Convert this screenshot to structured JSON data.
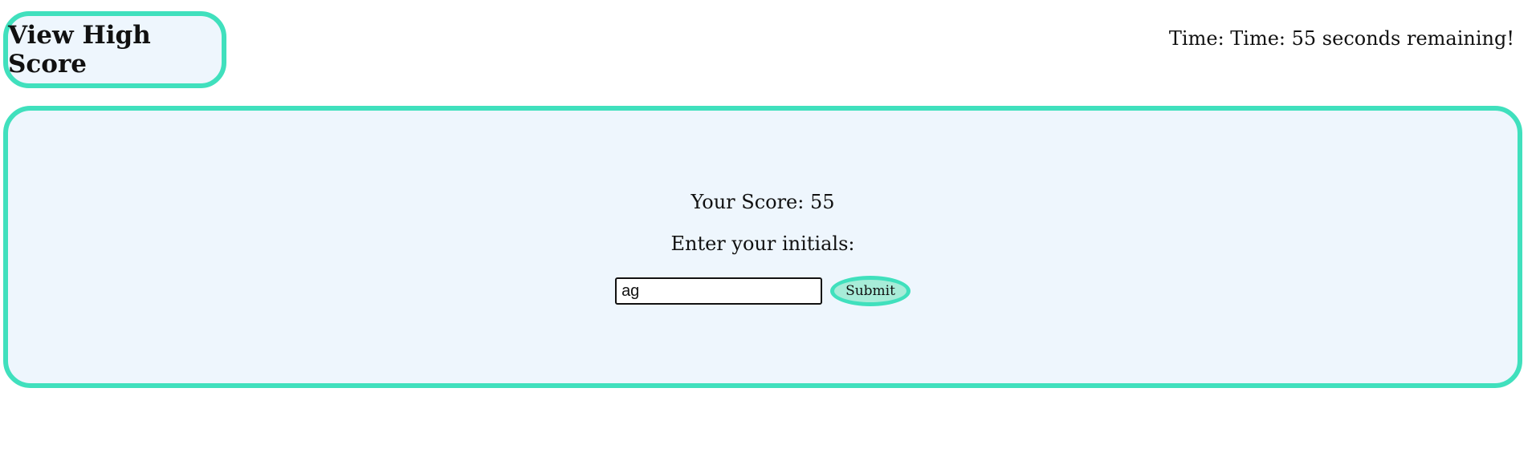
{
  "header": {
    "view_high_score_label": "View High Score",
    "timer_text": "Time: Time: 55 seconds remaining!"
  },
  "score_card": {
    "score_text": "Your Score: 55",
    "initials_prompt": "Enter your initials:",
    "initials_value": "ag",
    "submit_label": "Submit"
  },
  "colors": {
    "accent_border": "#40e0bd",
    "card_background": "#eef6fd",
    "button_fill": "#a8ecd8"
  }
}
